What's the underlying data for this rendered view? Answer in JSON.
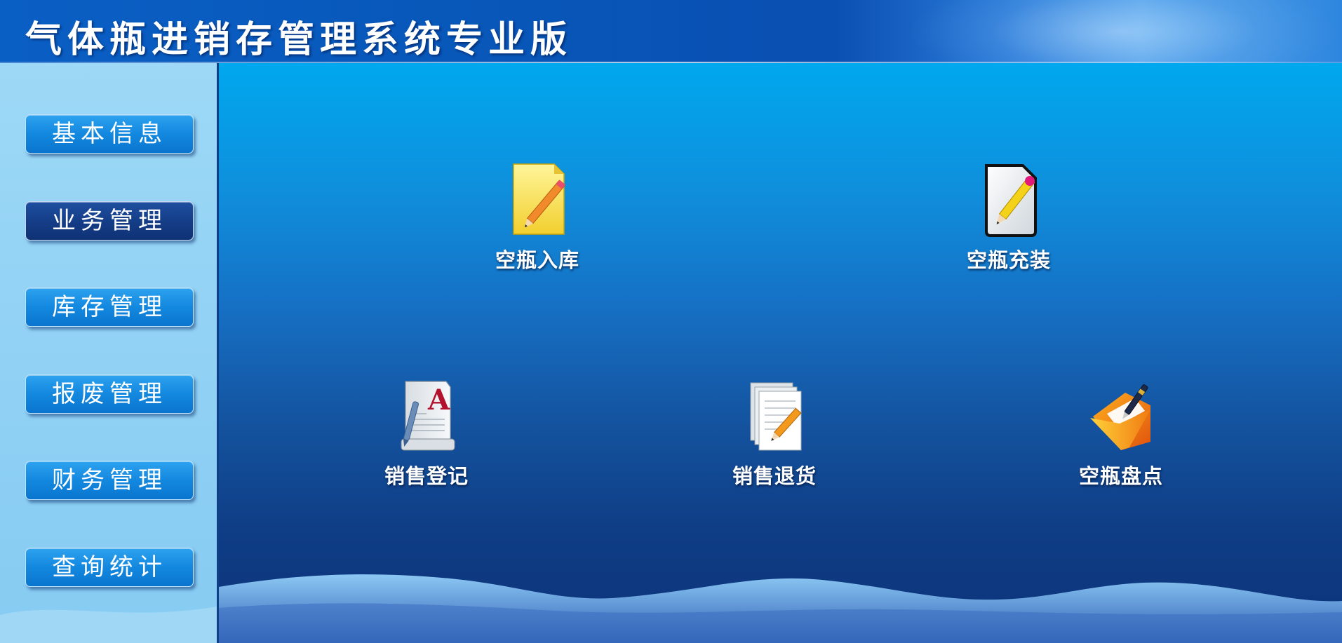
{
  "header": {
    "title": "气体瓶进销存管理系统专业版"
  },
  "sidebar": {
    "items": [
      {
        "label": "基本信息",
        "active": false
      },
      {
        "label": "业务管理",
        "active": true
      },
      {
        "label": "库存管理",
        "active": false
      },
      {
        "label": "报废管理",
        "active": false
      },
      {
        "label": "财务管理",
        "active": false
      },
      {
        "label": "查询统计",
        "active": false
      }
    ]
  },
  "main": {
    "tiles": [
      {
        "label": "空瓶入库",
        "icon": "notepad-pencil-icon"
      },
      {
        "label": "空瓶充装",
        "icon": "document-edit-icon"
      },
      {
        "label": "销售登记",
        "icon": "text-editor-icon"
      },
      {
        "label": "销售退货",
        "icon": "document-pencil-icon"
      },
      {
        "label": "空瓶盘点",
        "icon": "folder-pen-icon"
      }
    ]
  },
  "colors": {
    "header": "#0a5fc4",
    "sidebar": "#9dd8f6",
    "nav_button": "#1388df",
    "nav_button_active": "#143c86",
    "main_top": "#00a8ee",
    "main_bottom": "#0c3279"
  }
}
